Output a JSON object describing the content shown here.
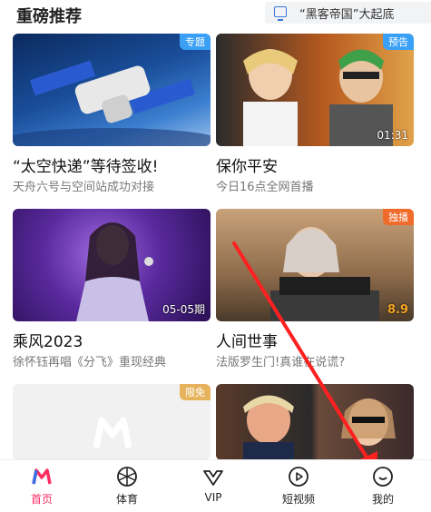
{
  "header": {
    "section_title": "重磅推荐",
    "search_text": "“黑客帝国”大起底"
  },
  "cards": [
    {
      "title": "“太空快递”等待签收!",
      "subtitle": "天舟六号与空间站成功对接",
      "badge": "专题",
      "corner": ""
    },
    {
      "title": "保你平安",
      "subtitle": "今日16点全网首播",
      "badge": "预告",
      "corner": "01:31"
    },
    {
      "title": "乘风2023",
      "subtitle": "徐怀钰再唱《分飞》重现经典",
      "badge": "",
      "corner": "05-05期"
    },
    {
      "title": "人间世事",
      "subtitle": "法版罗生门!真谁在说谎?",
      "badge": "独播",
      "corner": "8.9"
    },
    {
      "title": "",
      "subtitle": "",
      "badge": "限免",
      "corner": ""
    }
  ],
  "tabs": [
    {
      "label": "首页",
      "icon": "home-logo-icon"
    },
    {
      "label": "体育",
      "icon": "sports-ball-icon"
    },
    {
      "label": "VIP",
      "icon": "vip-crown-icon"
    },
    {
      "label": "短视频",
      "icon": "short-video-play-icon"
    },
    {
      "label": "我的",
      "icon": "profile-icon"
    }
  ],
  "colors": {
    "accent": "#ff2b62",
    "badge_blue": "#3aa0f5",
    "badge_orange": "#f06a2a",
    "badge_gold": "#e6b35c"
  }
}
